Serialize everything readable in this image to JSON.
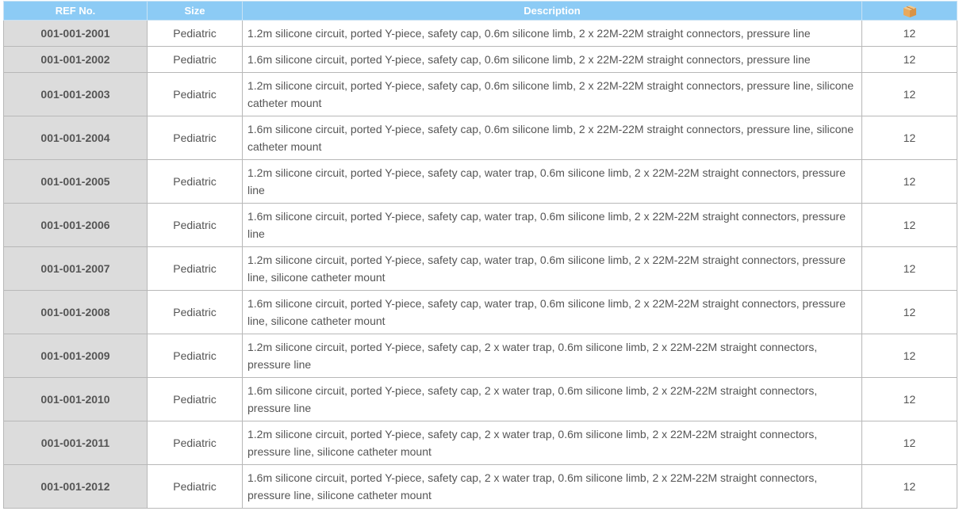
{
  "table": {
    "headers": {
      "ref": "REF No.",
      "size": "Size",
      "description": "Description",
      "qty_icon": "box-icon"
    },
    "rows": [
      {
        "ref": "001-001-2001",
        "size": "Pediatric",
        "description": "1.2m silicone circuit, ported Y-piece, safety cap, 0.6m silicone limb, 2 x 22M-22M straight connectors, pressure line",
        "qty": "12"
      },
      {
        "ref": "001-001-2002",
        "size": "Pediatric",
        "description": "1.6m silicone circuit, ported Y-piece, safety cap, 0.6m silicone limb, 2 x 22M-22M straight connectors, pressure line",
        "qty": "12"
      },
      {
        "ref": "001-001-2003",
        "size": "Pediatric",
        "description": "1.2m silicone circuit, ported Y-piece, safety cap, 0.6m silicone limb, 2 x 22M-22M straight connectors, pressure line, silicone catheter mount",
        "qty": "12"
      },
      {
        "ref": "001-001-2004",
        "size": "Pediatric",
        "description": "1.6m silicone circuit, ported Y-piece, safety cap, 0.6m silicone limb, 2 x 22M-22M straight connectors, pressure line, silicone catheter mount",
        "qty": "12"
      },
      {
        "ref": "001-001-2005",
        "size": "Pediatric",
        "description": "1.2m silicone circuit, ported Y-piece, safety cap, water trap, 0.6m silicone limb, 2 x 22M-22M straight connectors, pressure line",
        "qty": "12"
      },
      {
        "ref": "001-001-2006",
        "size": "Pediatric",
        "description": "1.6m silicone circuit, ported Y-piece, safety cap, water trap, 0.6m silicone limb, 2 x 22M-22M straight connectors, pressure line",
        "qty": "12"
      },
      {
        "ref": "001-001-2007",
        "size": "Pediatric",
        "description": "1.2m silicone circuit, ported Y-piece, safety cap, water trap, 0.6m silicone limb, 2 x 22M-22M straight connectors, pressure line, silicone catheter mount",
        "qty": "12"
      },
      {
        "ref": "001-001-2008",
        "size": "Pediatric",
        "description": "1.6m silicone circuit, ported Y-piece, safety cap, water trap, 0.6m silicone limb, 2 x 22M-22M straight connectors, pressure line, silicone catheter mount",
        "qty": "12"
      },
      {
        "ref": "001-001-2009",
        "size": "Pediatric",
        "description": "1.2m silicone circuit, ported Y-piece, safety cap, 2 x water trap, 0.6m silicone limb, 2 x 22M-22M straight connectors, pressure line",
        "qty": "12"
      },
      {
        "ref": "001-001-2010",
        "size": "Pediatric",
        "description": "1.6m silicone circuit, ported Y-piece, safety cap, 2 x water trap, 0.6m silicone limb, 2 x 22M-22M straight connectors, pressure line",
        "qty": "12"
      },
      {
        "ref": "001-001-2011",
        "size": "Pediatric",
        "description": "1.2m silicone circuit, ported Y-piece, safety cap, 2 x water trap, 0.6m silicone limb, 2 x 22M-22M straight connectors, pressure line, silicone catheter mount",
        "qty": "12"
      },
      {
        "ref": "001-001-2012",
        "size": "Pediatric",
        "description": "1.6m silicone circuit, ported Y-piece, safety cap, 2 x water trap, 0.6m silicone limb, 2 x 22M-22M straight connectors, pressure line, silicone catheter mount",
        "qty": "12"
      }
    ]
  },
  "colors": {
    "header_bg": "#8ccbf5",
    "ref_bg": "#dcdcdc",
    "border": "#b8b8b8",
    "text": "#555555"
  }
}
